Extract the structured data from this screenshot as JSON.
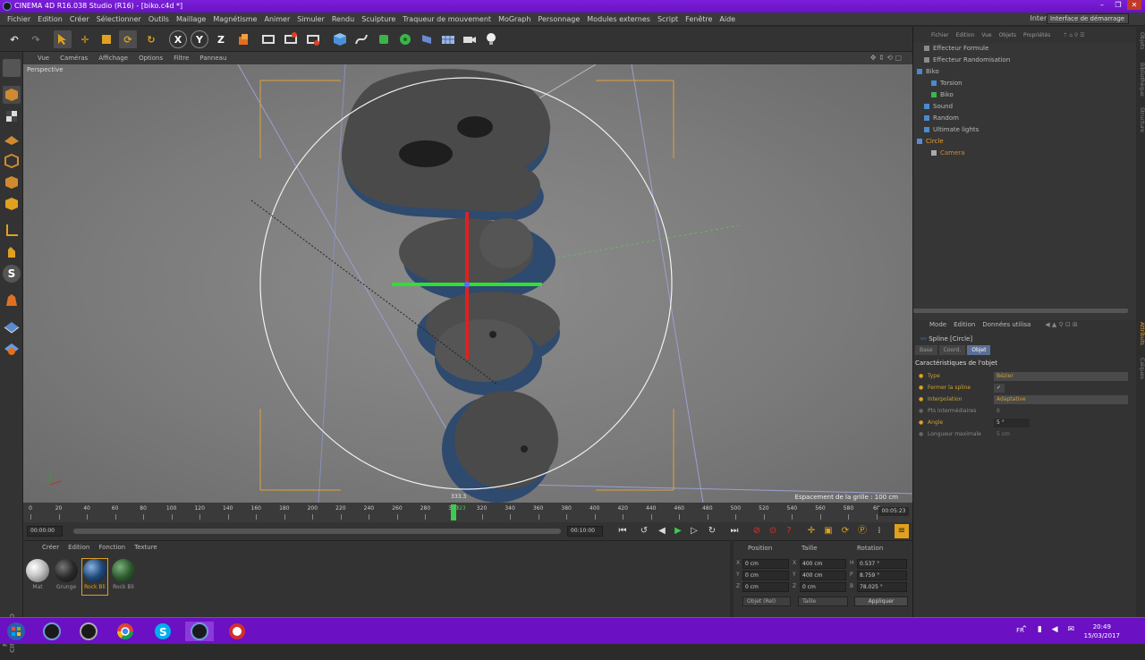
{
  "window": {
    "title": "CINEMA 4D R16.038 Studio (R16) - [biko.c4d *]",
    "controls": [
      "–",
      "❐",
      "✕"
    ]
  },
  "menubar": {
    "items": [
      "Fichier",
      "Edition",
      "Créer",
      "Sélectionner",
      "Outils",
      "Maillage",
      "Magnétisme",
      "Animer",
      "Simuler",
      "Rendu",
      "Sculpture",
      "Traqueur de mouvement",
      "MoGraph",
      "Personnage",
      "Modules externes",
      "Script",
      "Fenêtre",
      "Aide"
    ],
    "interface_label": "Interface:",
    "interface_value": "Interface de démarrage"
  },
  "toolbar": {
    "axis_x": "X",
    "axis_y": "Y",
    "axis_z": "Z"
  },
  "viewport": {
    "menu": [
      "Vue",
      "Caméras",
      "Affichage",
      "Options",
      "Filtre",
      "Panneau"
    ],
    "label": "Perspective",
    "grid_spacing": "Espacement de la grille : 100 cm",
    "frame_marker": "333.3"
  },
  "timeline": {
    "ticks": [
      "0",
      "20",
      "40",
      "60",
      "80",
      "100",
      "120",
      "140",
      "160",
      "180",
      "200",
      "220",
      "240",
      "260",
      "280",
      "300",
      "320",
      "340",
      "360",
      "380",
      "400",
      "420",
      "440",
      "460",
      "480",
      "500",
      "520",
      "540",
      "560",
      "580",
      "60"
    ],
    "current": "323",
    "end_field": "00:05:23",
    "current_fraction": 0.5
  },
  "transport": {
    "start_time": "00:00:00",
    "end_time": "00:10:00"
  },
  "materials": {
    "menu": [
      "Créer",
      "Edition",
      "Fonction",
      "Texture"
    ],
    "items": [
      {
        "label": "Mat",
        "color": "#c8c8c8"
      },
      {
        "label": "Grunge",
        "color": "#2a2a2a"
      },
      {
        "label": "Rock Bli",
        "color": "#1e4a7a"
      },
      {
        "label": "Rock Bli",
        "color": "#2f5a2f"
      }
    ],
    "brand": "MAXON CINEMA 4D"
  },
  "coords": {
    "headers": [
      "Position",
      "Taille",
      "Rotation"
    ],
    "rows": [
      {
        "axis": "X",
        "pos": "0 cm",
        "size_axis": "X",
        "size": "400 cm",
        "rot_axis": "H",
        "rot": "0.537 °"
      },
      {
        "axis": "Y",
        "pos": "0 cm",
        "size_axis": "Y",
        "size": "400 cm",
        "rot_axis": "P",
        "rot": "8.759 °"
      },
      {
        "axis": "Z",
        "pos": "0 cm",
        "size_axis": "Z",
        "size": "0 cm",
        "rot_axis": "B",
        "rot": "78.025 °"
      }
    ],
    "mode_select": "Objet (Rel)",
    "size_select": "Taille",
    "apply_label": "Appliquer"
  },
  "objects": {
    "menu": [
      "Fichier",
      "Edition",
      "Vue",
      "Objets",
      "Propriétés"
    ],
    "items": [
      {
        "name": "Effecteur Formule",
        "indent": 1,
        "color": "#c8c8c8"
      },
      {
        "name": "Effecteur Randomisation",
        "indent": 1,
        "color": "#c8c8c8"
      },
      {
        "name": "Biko",
        "indent": 0,
        "color": "#c8c8c8"
      },
      {
        "name": "Torsion",
        "indent": 2,
        "color": "#c8c8c8"
      },
      {
        "name": "Biko",
        "indent": 2,
        "color": "#c8c8c8"
      },
      {
        "name": "Sound",
        "indent": 1,
        "color": "#c8c8c8"
      },
      {
        "name": "Random",
        "indent": 1,
        "color": "#c8c8c8"
      },
      {
        "name": "Ultimate lights",
        "indent": 1,
        "color": "#c8c8c8"
      },
      {
        "name": "Circle",
        "indent": 1,
        "color": "#e8a030"
      },
      {
        "name": "Camera",
        "indent": 2,
        "color": "#d08a30"
      }
    ]
  },
  "side_tabs": [
    "Objets",
    "Bibliothèque",
    "Structure",
    "Attributs",
    "Calques"
  ],
  "attributes": {
    "menu": [
      "Mode",
      "Edition",
      "Données utilisa"
    ],
    "title": "Spline [Circle]",
    "tabs": [
      "Base",
      "Coord.",
      "Objet"
    ],
    "active_tab": "Objet",
    "section": "Caractéristiques de l'objet",
    "rows": [
      {
        "label": "Type",
        "value": "Bézier"
      },
      {
        "label": "Fermer la spline",
        "value": "✓"
      },
      {
        "label": "Interpolation",
        "value": "Adaptative"
      },
      {
        "label": "Pts intermédiaires",
        "value": "8"
      },
      {
        "label": "Angle",
        "value": "5 °"
      },
      {
        "label": "Longueur maximale",
        "value": "5 cm"
      }
    ]
  },
  "taskbar": {
    "lang": "FR",
    "time": "20:49",
    "date": "15/03/2017"
  }
}
